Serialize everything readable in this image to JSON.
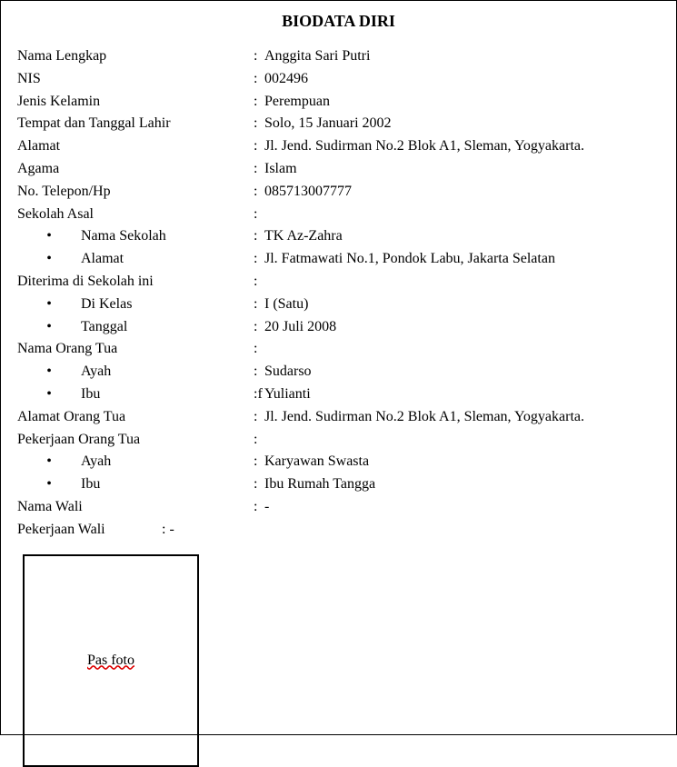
{
  "title": "BIODATA DIRI",
  "sep": ":",
  "labels": {
    "nama_lengkap": "Nama Lengkap",
    "nis": "NIS",
    "jenis_kelamin": "Jenis Kelamin",
    "ttl": "Tempat dan Tanggal Lahir",
    "alamat": "Alamat",
    "agama": "Agama",
    "telepon": "No. Telepon/Hp",
    "sekolah_asal": "Sekolah Asal",
    "sekolah_asal_nama": "Nama Sekolah",
    "sekolah_asal_alamat": "Alamat",
    "diterima": "Diterima di Sekolah ini",
    "diterima_kelas": "Di Kelas",
    "diterima_tanggal": "Tanggal",
    "ortu": "Nama Orang Tua",
    "ayah": "Ayah",
    "ibu": "Ibu",
    "alamat_ortu": "Alamat Orang Tua",
    "pekerjaan_ortu": "Pekerjaan Orang Tua",
    "nama_wali": "Nama Wali",
    "pekerjaan_wali": "Pekerjaan Wali"
  },
  "values": {
    "nama_lengkap": "Anggita Sari Putri",
    "nis": "002496",
    "jenis_kelamin": "Perempuan",
    "ttl": "Solo, 15 Januari 2002",
    "alamat": "Jl. Jend. Sudirman No.2 Blok A1, Sleman, Yogyakarta.",
    "agama": "Islam",
    "telepon": "085713007777",
    "sekolah_asal": "",
    "sekolah_asal_nama": "TK Az-Zahra",
    "sekolah_asal_alamat": "Jl. Fatmawati No.1, Pondok Labu, Jakarta Selatan",
    "diterima": "",
    "diterima_kelas": "I (Satu)",
    "diterima_tanggal": "20 Juli 2008",
    "ortu": "",
    "ortu_ayah": "Sudarso",
    "ortu_ibu_sep": ":f",
    "ortu_ibu": "Yulianti",
    "alamat_ortu": "Jl. Jend. Sudirman No.2 Blok A1, Sleman, Yogyakarta.",
    "pekerjaan_ortu": "",
    "pekerjaan_ayah": "Karyawan Swasta",
    "pekerjaan_ibu": "Ibu Rumah Tangga",
    "nama_wali": "-",
    "pekerjaan_wali_sep": ": -"
  },
  "bullet": "•",
  "photo_label": "Pas foto"
}
